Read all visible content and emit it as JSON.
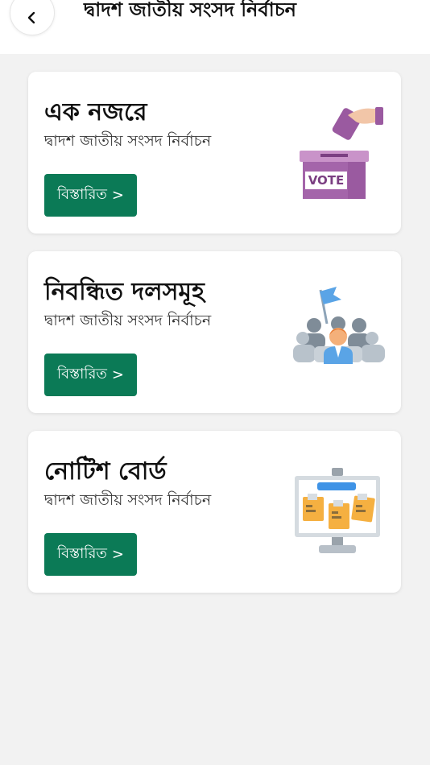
{
  "header": {
    "title": "দ্বাদশ জাতীয় সংসদ নির্বাচন",
    "back_icon": "chevron-left-icon"
  },
  "cards": [
    {
      "title": "এক নজরে",
      "subtitle": "দ্বাদশ জাতীয় সংসদ নির্বাচন",
      "button_label": "বিস্তারিত",
      "button_chevron": ">",
      "illustration": "ballot-box-icon",
      "illustration_text": "VOTE"
    },
    {
      "title": "নিবন্ধিত দলসমূহ",
      "subtitle": "দ্বাদশ জাতীয় সংসদ নির্বাচন",
      "button_label": "বিস্তারিত",
      "button_chevron": ">",
      "illustration": "political-party-icon"
    },
    {
      "title": "নোটিশ বোর্ড",
      "subtitle": "দ্বাদশ জাতীয় সংসদ নির্বাচন",
      "button_label": "বিস্তারিত",
      "button_chevron": ">",
      "illustration": "notice-board-icon"
    }
  ],
  "colors": {
    "button_bg": "#0b7a56",
    "page_bg": "#f2f2f2",
    "card_bg": "#ffffff"
  }
}
